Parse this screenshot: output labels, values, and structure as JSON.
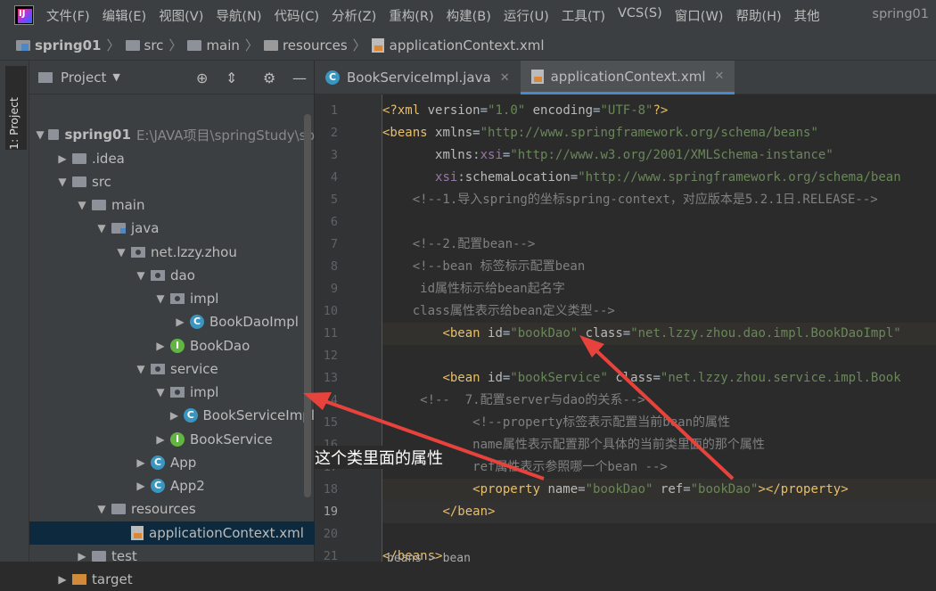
{
  "menubar": {
    "items": [
      "文件(F)",
      "编辑(E)",
      "视图(V)",
      "导航(N)",
      "代码(C)",
      "分析(Z)",
      "重构(R)",
      "构建(B)",
      "运行(U)",
      "工具(T)",
      "VCS(S)",
      "窗口(W)",
      "帮助(H)",
      "其他"
    ],
    "project_name": "spring01"
  },
  "breadcrumb": {
    "items": [
      "spring01",
      "src",
      "main",
      "resources",
      "applicationContext.xml"
    ]
  },
  "toolstrip": {
    "label": "1: Project"
  },
  "project_panel": {
    "title": "Project",
    "tree": [
      {
        "label": "spring01",
        "path": "E:\\JAVA项目\\springStudy\\sp",
        "indent": 0,
        "arrow": "▼",
        "icon": "folder-proj",
        "bold": true
      },
      {
        "label": ".idea",
        "indent": 1,
        "arrow": "▶",
        "icon": "folder"
      },
      {
        "label": "src",
        "indent": 1,
        "arrow": "▼",
        "icon": "folder"
      },
      {
        "label": "main",
        "indent": 2,
        "arrow": "▼",
        "icon": "folder"
      },
      {
        "label": "java",
        "indent": 3,
        "arrow": "▼",
        "icon": "folder-blue"
      },
      {
        "label": "net.lzzy.zhou",
        "indent": 4,
        "arrow": "▼",
        "icon": "package"
      },
      {
        "label": "dao",
        "indent": 5,
        "arrow": "▼",
        "icon": "package"
      },
      {
        "label": "impl",
        "indent": 6,
        "arrow": "▼",
        "icon": "package"
      },
      {
        "label": "BookDaoImpl",
        "indent": 7,
        "arrow": "▶",
        "icon": "class"
      },
      {
        "label": "BookDao",
        "indent": 6,
        "arrow": "▶",
        "icon": "interface"
      },
      {
        "label": "service",
        "indent": 5,
        "arrow": "▼",
        "icon": "package"
      },
      {
        "label": "impl",
        "indent": 6,
        "arrow": "▼",
        "icon": "package"
      },
      {
        "label": "BookServiceImpl",
        "indent": 7,
        "arrow": "▶",
        "icon": "class"
      },
      {
        "label": "BookService",
        "indent": 6,
        "arrow": "▶",
        "icon": "interface"
      },
      {
        "label": "App",
        "indent": 5,
        "arrow": "▶",
        "icon": "class"
      },
      {
        "label": "App2",
        "indent": 5,
        "arrow": "▶",
        "icon": "class"
      },
      {
        "label": "resources",
        "indent": 3,
        "arrow": "▼",
        "icon": "folder"
      },
      {
        "label": "applicationContext.xml",
        "indent": 4,
        "arrow": "",
        "icon": "xml",
        "selected": true
      },
      {
        "label": "test",
        "indent": 2,
        "arrow": "▶",
        "icon": "folder"
      },
      {
        "label": "target",
        "indent": 1,
        "arrow": "▶",
        "icon": "folder-orange"
      }
    ]
  },
  "editor": {
    "tabs": [
      {
        "label": "BookServiceImpl.java",
        "active": false
      },
      {
        "label": "applicationContext.xml",
        "active": true
      }
    ],
    "current_line": 19,
    "lines": [
      {
        "n": "1",
        "segs": [
          [
            "c-punct",
            "<?"
          ],
          [
            "c-tag",
            "xml "
          ],
          [
            "c-attr",
            "version"
          ],
          [
            "c-text",
            "="
          ],
          [
            "c-val",
            "\"1.0\""
          ],
          [
            "c-attr",
            " encoding"
          ],
          [
            "c-text",
            "="
          ],
          [
            "c-val",
            "\"UTF-8\""
          ],
          [
            "c-punct",
            "?>"
          ]
        ]
      },
      {
        "n": "2",
        "segs": [
          [
            "c-tag",
            "<beans "
          ],
          [
            "c-attr",
            "xmlns"
          ],
          [
            "c-text",
            "="
          ],
          [
            "c-val",
            "\"http://www.springframework.org/schema/beans\""
          ]
        ]
      },
      {
        "n": "3",
        "segs": [
          [
            "c-text",
            "       "
          ],
          [
            "c-attr",
            "xmlns"
          ],
          [
            "c-text",
            ":"
          ],
          [
            "c-ns",
            "xsi"
          ],
          [
            "c-text",
            "="
          ],
          [
            "c-val",
            "\"http://www.w3.org/2001/XMLSchema-instance\""
          ]
        ]
      },
      {
        "n": "4",
        "segs": [
          [
            "c-text",
            "       "
          ],
          [
            "c-ns",
            "xsi"
          ],
          [
            "c-text",
            ":"
          ],
          [
            "c-attr",
            "schemaLocation"
          ],
          [
            "c-text",
            "="
          ],
          [
            "c-val",
            "\"http://www.springframework.org/schema/bean"
          ]
        ]
      },
      {
        "n": "5",
        "segs": [
          [
            "c-comment",
            "    <!--1.导入spring的坐标spring-context，对应版本是5.2.1日.RELEASE-->"
          ]
        ]
      },
      {
        "n": "6",
        "segs": []
      },
      {
        "n": "7",
        "segs": [
          [
            "c-comment",
            "    <!--2.配置bean-->"
          ]
        ]
      },
      {
        "n": "8",
        "segs": [
          [
            "c-comment",
            "    <!--bean 标签标示配置bean"
          ]
        ]
      },
      {
        "n": "9",
        "segs": [
          [
            "c-comment",
            "     id属性标示给bean起名字"
          ]
        ]
      },
      {
        "n": "10",
        "segs": [
          [
            "c-comment",
            "    class属性表示给bean定义类型-->"
          ]
        ]
      },
      {
        "n": "11",
        "segs": [
          [
            "c-text",
            "        "
          ],
          [
            "c-tag",
            "<bean "
          ],
          [
            "c-attr",
            "id"
          ],
          [
            "c-text",
            "="
          ],
          [
            "c-val",
            "\"bookDao\""
          ],
          [
            "c-attr",
            " class"
          ],
          [
            "c-text",
            "="
          ],
          [
            "c-val",
            "\"net.lzzy.zhou.dao.impl.BookDaoImpl\""
          ]
        ],
        "hl": true
      },
      {
        "n": "12",
        "segs": []
      },
      {
        "n": "13",
        "segs": [
          [
            "c-text",
            "        "
          ],
          [
            "c-tag",
            "<bean "
          ],
          [
            "c-attr",
            "id"
          ],
          [
            "c-text",
            "="
          ],
          [
            "c-val",
            "\"bookService\""
          ],
          [
            "c-attr",
            " class"
          ],
          [
            "c-text",
            "="
          ],
          [
            "c-val",
            "\"net.lzzy.zhou.service.impl.Book"
          ]
        ]
      },
      {
        "n": "14",
        "segs": [
          [
            "c-comment",
            "     <!--  7.配置server与dao的关系-->"
          ]
        ]
      },
      {
        "n": "15",
        "segs": [
          [
            "c-comment",
            "            <!--property标签表示配置当前bean的属性"
          ]
        ]
      },
      {
        "n": "16",
        "segs": [
          [
            "c-comment",
            "            name属性表示配置那个具体的当前类里面的那个属性"
          ]
        ]
      },
      {
        "n": "17",
        "segs": [
          [
            "c-comment",
            "            ref属性表示参照哪一个bean -->"
          ]
        ]
      },
      {
        "n": "18",
        "segs": [
          [
            "c-text",
            "            "
          ],
          [
            "c-tag",
            "<property "
          ],
          [
            "c-attr",
            "name"
          ],
          [
            "c-text",
            "="
          ],
          [
            "c-val",
            "\"bookDao\""
          ],
          [
            "c-attr",
            " ref"
          ],
          [
            "c-text",
            "="
          ],
          [
            "c-val",
            "\"bookDao\""
          ],
          [
            "c-tag",
            "></property>"
          ]
        ],
        "hl": true
      },
      {
        "n": "19",
        "segs": [
          [
            "c-text",
            "        "
          ],
          [
            "c-tag",
            "</bean>"
          ]
        ],
        "current": true
      },
      {
        "n": "20",
        "segs": []
      },
      {
        "n": "21",
        "segs": [
          [
            "c-tag",
            "</beans>"
          ]
        ]
      }
    ]
  },
  "annotation": {
    "text": "这个类里面的属性"
  },
  "status_breadcrumb": "beans > bean",
  "colors": {
    "annotation_arrow": "#e8423c",
    "selection": "#0d293e",
    "tab_underline": "#4a88c7"
  }
}
